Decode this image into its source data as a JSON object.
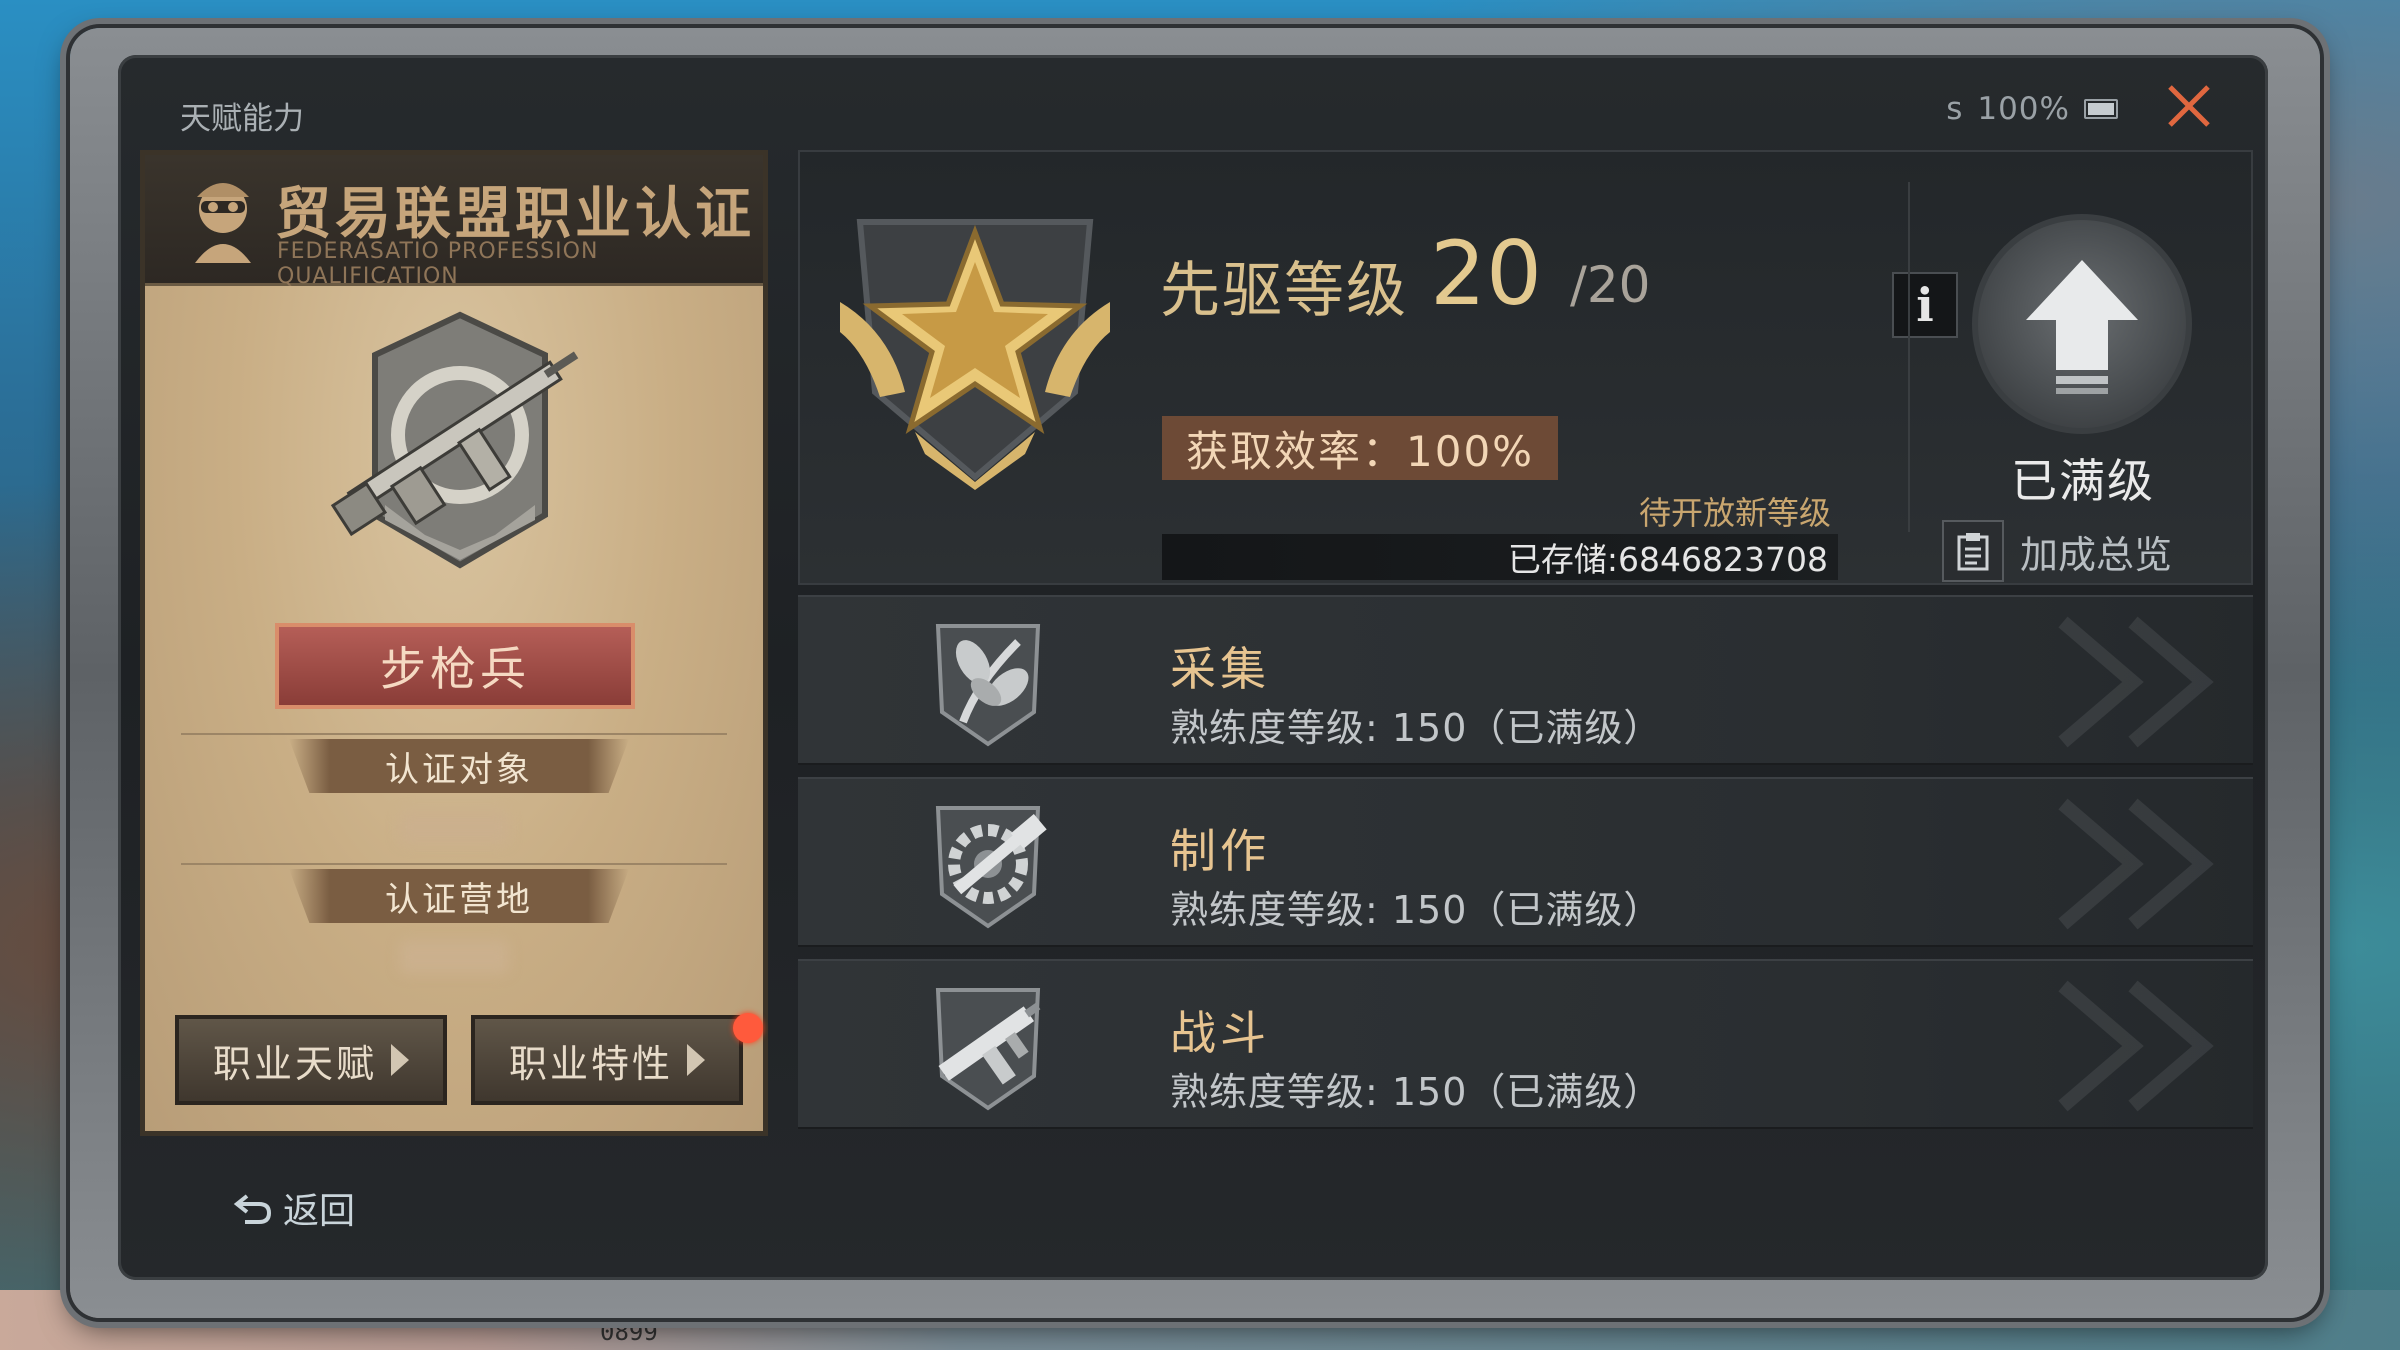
{
  "window": {
    "title": "天赋能力",
    "status_prefix": "s",
    "battery": "100%"
  },
  "card": {
    "title": "贸易联盟职业认证",
    "subtitle": "FEDERASATIO PROFESSION QUALIFICATION",
    "class_name": "步枪兵",
    "cert_target_label": "认证对象",
    "cert_camp_label": "认证营地",
    "btn_talent": "职业天赋",
    "btn_trait": "职业特性"
  },
  "pioneer": {
    "label": "先驱等级",
    "current": "20",
    "max": "/20",
    "info": "i",
    "efficiency": "获取效率：100%",
    "pending": "待开放新等级",
    "stored": "已存储:6846823708",
    "maxed": "已满级",
    "bonus": "加成总览"
  },
  "skills": [
    {
      "name": "采集",
      "level": "熟练度等级: 150（已满级）",
      "icon": "gather-icon"
    },
    {
      "name": "制作",
      "level": "熟练度等级: 150（已满级）",
      "icon": "craft-icon"
    },
    {
      "name": "战斗",
      "level": "熟练度等级: 150（已满级）",
      "icon": "combat-icon"
    }
  ],
  "footer": {
    "back": "返回",
    "bg_text": "0899"
  },
  "colors": {
    "accent_gold": "#e3c98f",
    "class_red": "#8a3d38",
    "close_orange": "#e0673f",
    "notify_dot": "#ff5a3c"
  }
}
